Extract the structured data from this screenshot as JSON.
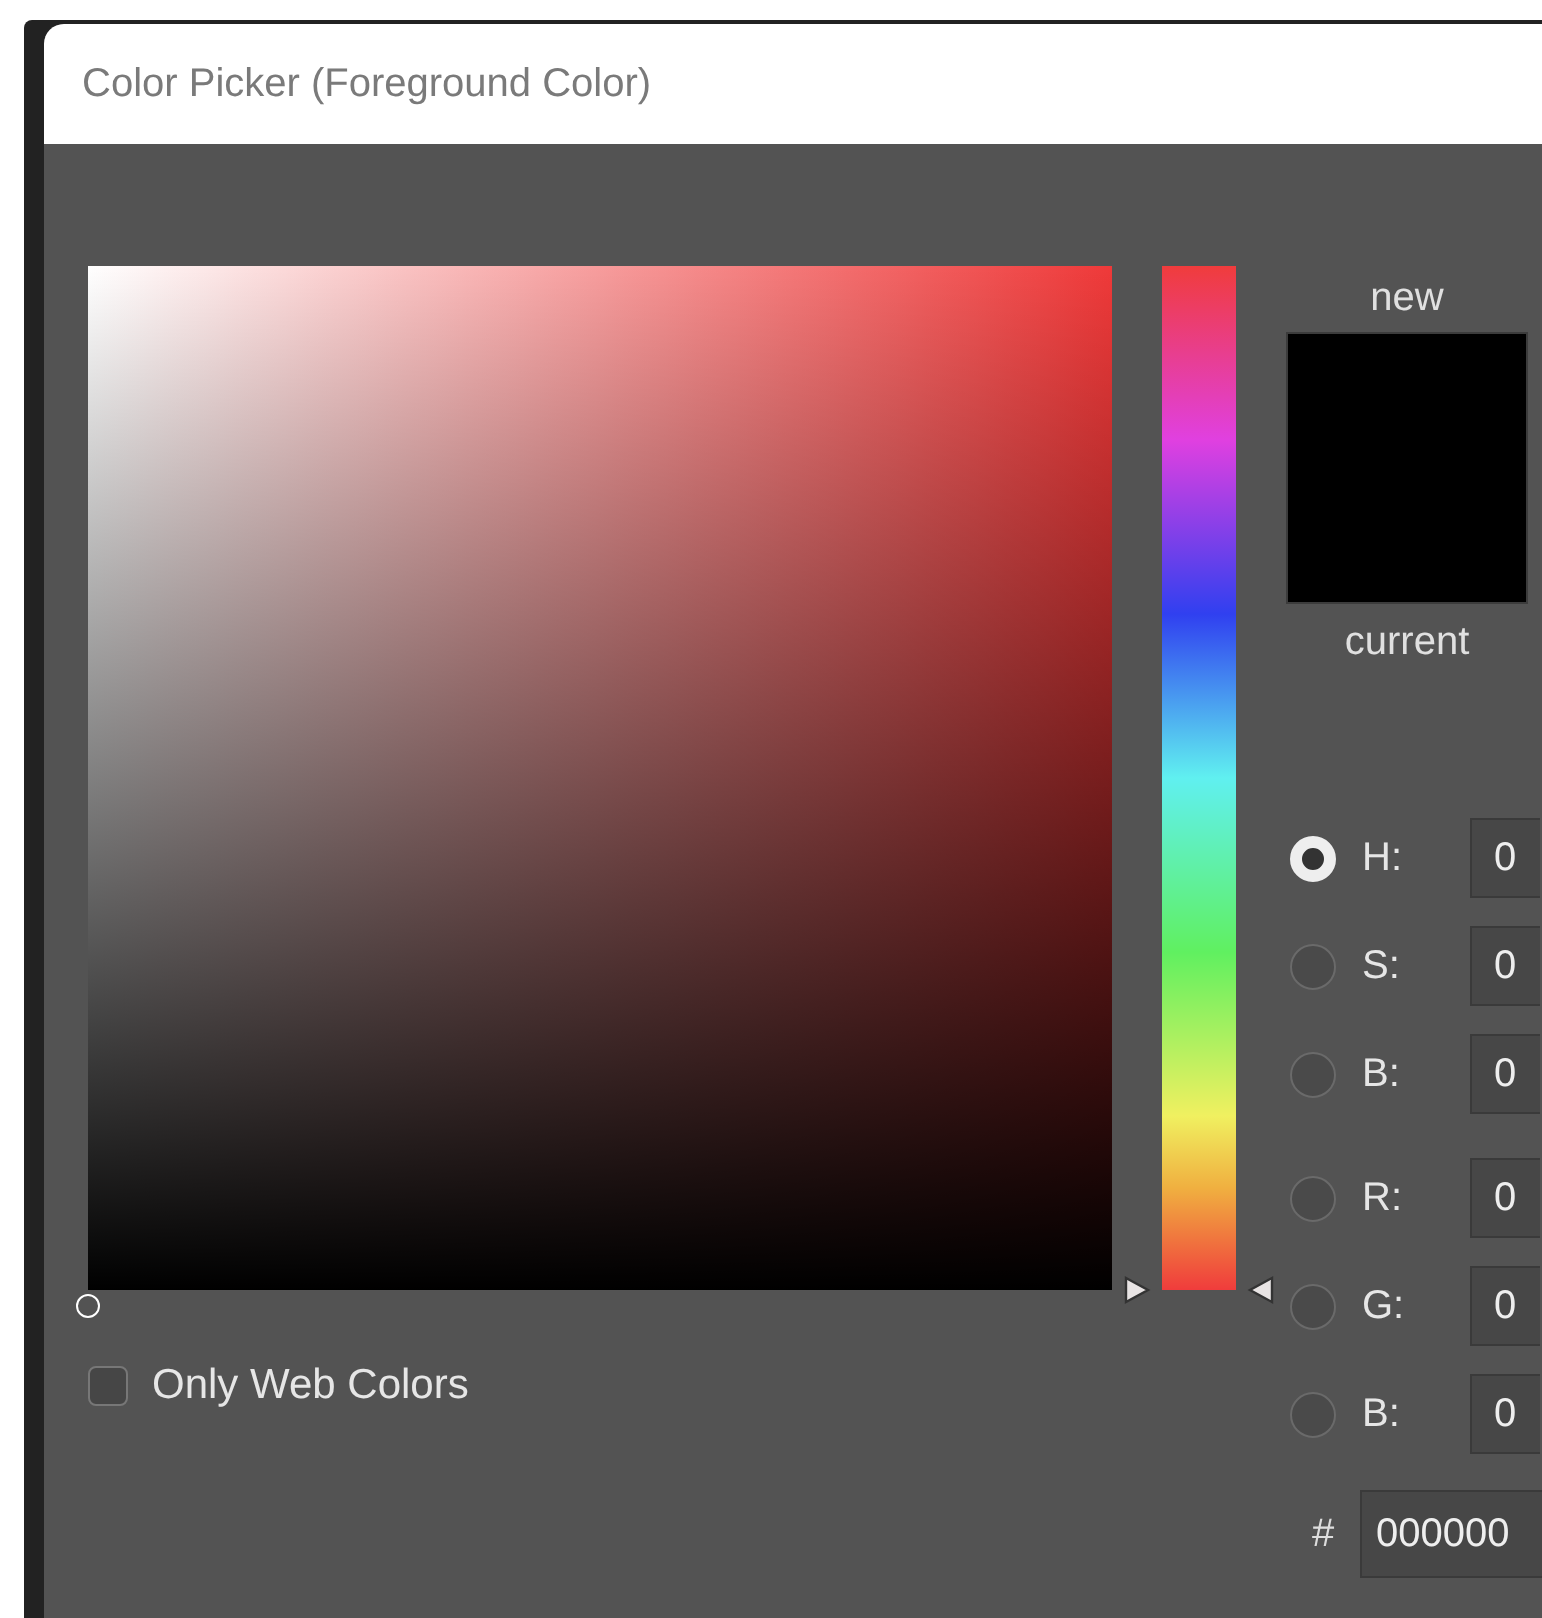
{
  "window": {
    "title": "Color Picker (Foreground Color)"
  },
  "hue_slider": {
    "level": 0
  },
  "swatches": [
    {
      "label": "new",
      "color": "#000000"
    },
    {
      "label": "current",
      "color": "#000000"
    }
  ],
  "modes": [
    {
      "label": "H:",
      "value": "0",
      "selected": true
    },
    {
      "label": "S:",
      "value": "0",
      "selected": false
    },
    {
      "label": "B:",
      "value": "0",
      "selected": false
    },
    {
      "label": "R:",
      "value": "0",
      "selected": false
    },
    {
      "label": "G:",
      "value": "0",
      "selected": false
    },
    {
      "label": "B:",
      "value": "0",
      "selected": false
    }
  ],
  "hex": {
    "label": "#",
    "value": "000000"
  },
  "only_web_colors": {
    "label": "Only Web Colors",
    "checked": false
  }
}
